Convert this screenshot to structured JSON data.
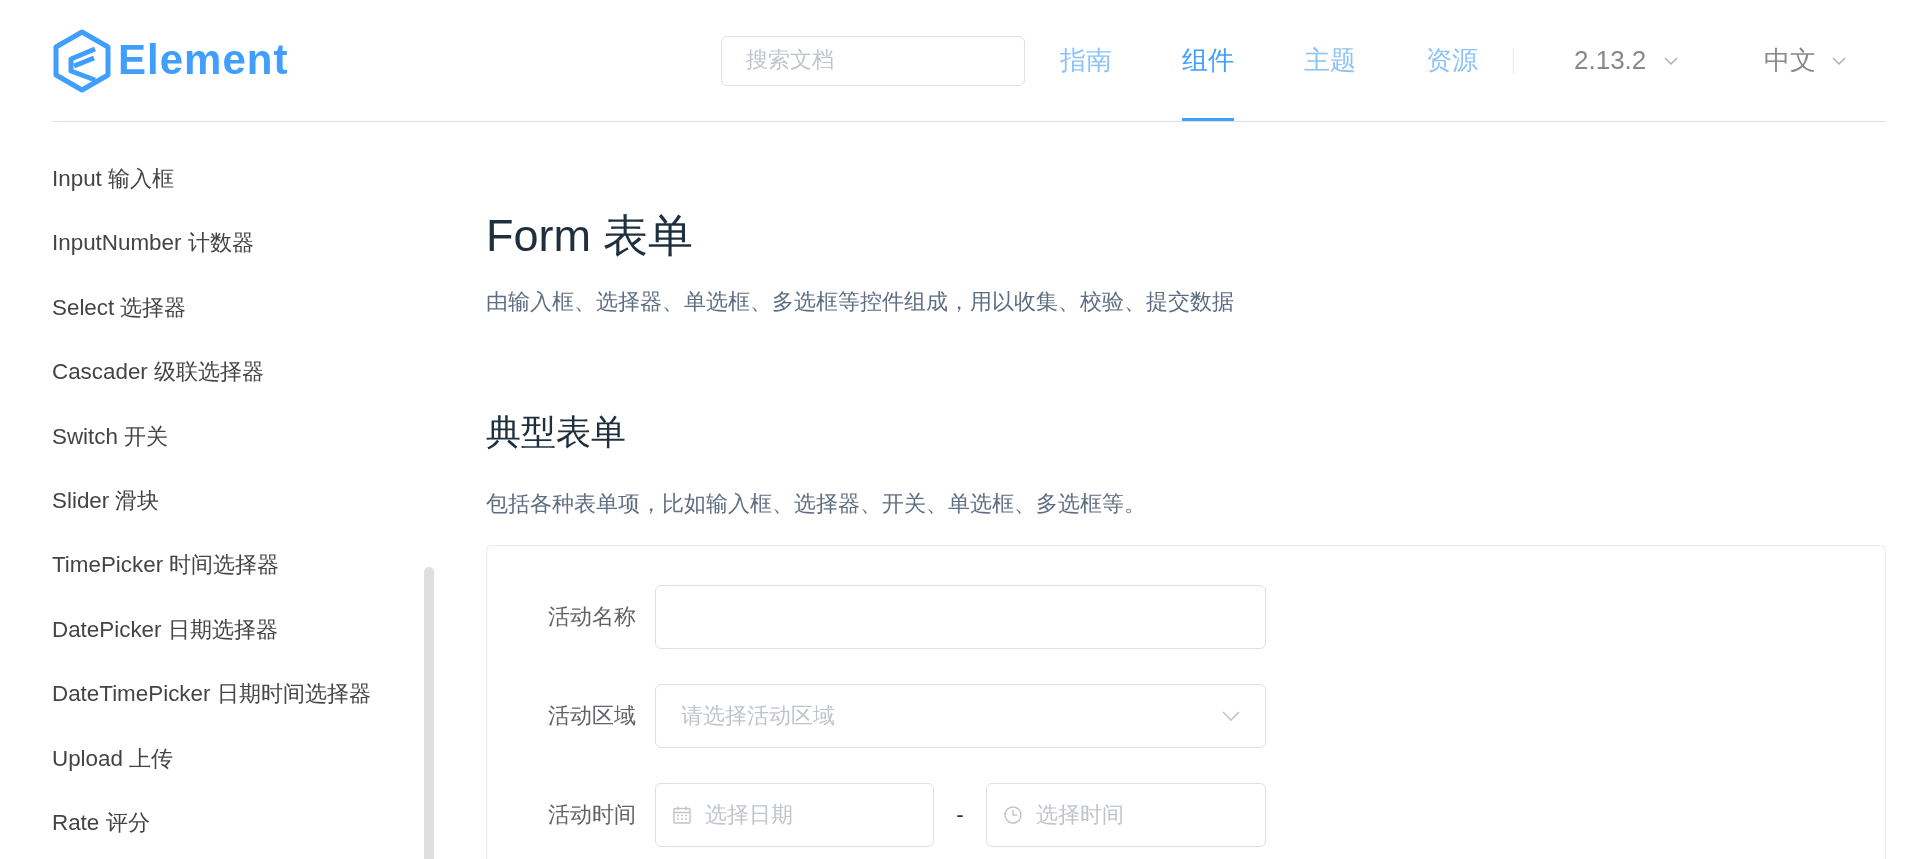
{
  "header": {
    "logo": {
      "text": "Element"
    },
    "search": {
      "placeholder": "搜索文档"
    },
    "nav": [
      {
        "label": "指南",
        "selected": false
      },
      {
        "label": "组件",
        "selected": true
      },
      {
        "label": "主题",
        "selected": false
      },
      {
        "label": "资源",
        "selected": false
      }
    ],
    "version": {
      "label": "2.13.2"
    },
    "language": {
      "label": "中文"
    }
  },
  "sidebar": {
    "items": [
      {
        "label": "Input 输入框",
        "selected": false
      },
      {
        "label": "InputNumber 计数器",
        "selected": false
      },
      {
        "label": "Select 选择器",
        "selected": false
      },
      {
        "label": "Cascader 级联选择器",
        "selected": false
      },
      {
        "label": "Switch 开关",
        "selected": false
      },
      {
        "label": "Slider 滑块",
        "selected": false
      },
      {
        "label": "TimePicker 时间选择器",
        "selected": false
      },
      {
        "label": "DatePicker 日期选择器",
        "selected": false
      },
      {
        "label": "DateTimePicker 日期时间选择器",
        "selected": false
      },
      {
        "label": "Upload 上传",
        "selected": false
      },
      {
        "label": "Rate 评分",
        "selected": false
      }
    ]
  },
  "page": {
    "title": "Form 表单",
    "description": "由输入框、选择器、单选框、多选框等控件组成，用以收集、校验、提交数据"
  },
  "section": {
    "title": "典型表单",
    "description": "包括各种表单项，比如输入框、选择器、开关、单选框、多选框等。"
  },
  "demo_form": {
    "items": [
      {
        "label": "活动名称",
        "kind": "input"
      },
      {
        "label": "活动区域",
        "kind": "select",
        "placeholder": "请选择活动区域"
      },
      {
        "label": "活动时间",
        "kind": "range",
        "separator": "-",
        "fields": [
          {
            "kind": "date",
            "placeholder": "选择日期"
          },
          {
            "kind": "time",
            "placeholder": "选择时间"
          }
        ]
      }
    ]
  }
}
